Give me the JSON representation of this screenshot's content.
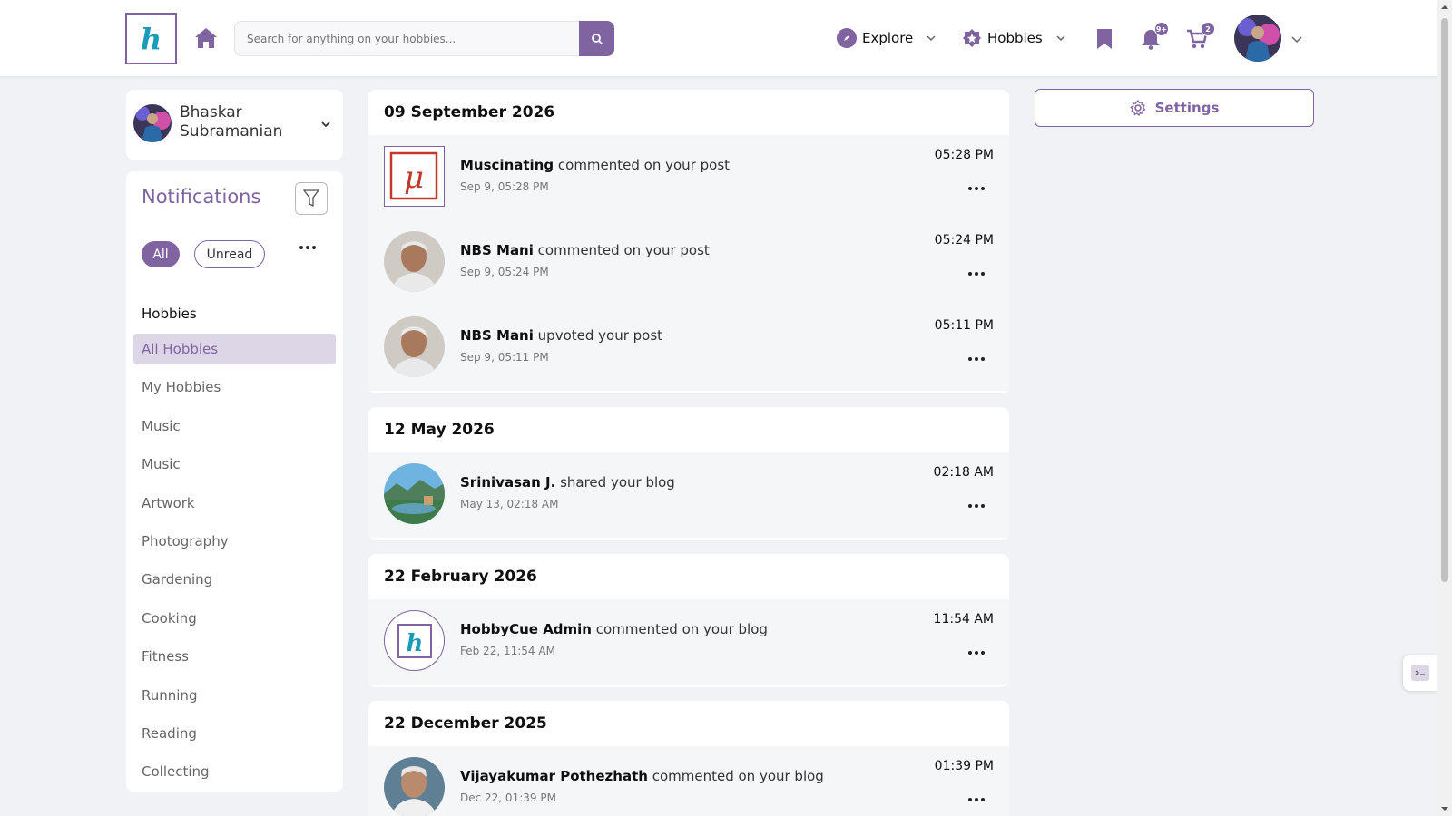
{
  "header": {
    "logo_letter": "h",
    "search_placeholder": "Search for anything on your hobbies...",
    "nav_explore": "Explore",
    "nav_hobbies": "Hobbies",
    "notification_badge": "9+",
    "cart_badge": "2"
  },
  "profile": {
    "name": "Bhaskar Subramanian"
  },
  "sidebar": {
    "title": "Notifications",
    "chip_all": "All",
    "chip_unread": "Unread",
    "hobbies_heading": "Hobbies",
    "hobbies": [
      {
        "label": "All Hobbies",
        "active": true
      },
      {
        "label": "My Hobbies"
      },
      {
        "label": "Music"
      },
      {
        "label": "Music"
      },
      {
        "label": "Artwork"
      },
      {
        "label": "Photography"
      },
      {
        "label": "Gardening"
      },
      {
        "label": "Cooking"
      },
      {
        "label": "Fitness"
      },
      {
        "label": "Running"
      },
      {
        "label": "Reading"
      },
      {
        "label": "Collecting"
      }
    ]
  },
  "settings_label": "Settings",
  "groups": [
    {
      "date": "09 September 2026",
      "items": [
        {
          "actor": "Muscinating",
          "action": "commented on your post",
          "sub": "Sep 9, 05:28 PM",
          "time": "05:28 PM",
          "avatar": "mu-logo"
        },
        {
          "actor": "NBS Mani",
          "action": "commented on your post",
          "sub": "Sep 9, 05:24 PM",
          "time": "05:24 PM",
          "avatar": "person"
        },
        {
          "actor": "NBS Mani",
          "action": "upvoted your post",
          "sub": "Sep 9, 05:11 PM",
          "time": "05:11 PM",
          "avatar": "person"
        }
      ]
    },
    {
      "date": "12 May 2026",
      "items": [
        {
          "actor": "Srinivasan J.",
          "action": "shared your blog",
          "sub": "May 13, 02:18 AM",
          "time": "02:18 AM",
          "avatar": "landscape"
        }
      ]
    },
    {
      "date": "22 February 2026",
      "items": [
        {
          "actor": "HobbyCue Admin",
          "action": "commented on your blog",
          "sub": "Feb 22, 11:54 AM",
          "time": "11:54 AM",
          "avatar": "h-logo"
        }
      ]
    },
    {
      "date": "22 December 2025",
      "items": [
        {
          "actor": "Vijayakumar Pothezhath",
          "action": "commented on your blog",
          "sub": "Dec 22, 01:39 PM",
          "time": "01:39 PM",
          "avatar": "person"
        }
      ]
    }
  ],
  "colors": {
    "accent": "#8064a2",
    "logo_h": "#1a9cb8",
    "background": "#f1f2f6"
  }
}
